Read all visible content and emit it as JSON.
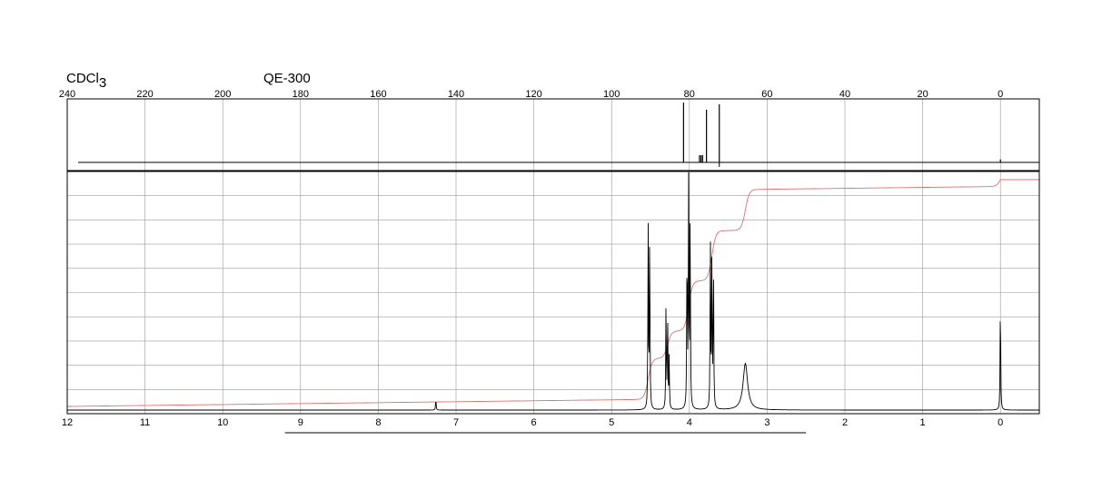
{
  "header": {
    "solvent_prefix": "CDCl",
    "solvent_subscript": "3",
    "instrument": "QE-300"
  },
  "colors": {
    "background": "#ffffff",
    "frame": "#000000",
    "grid": "#9a9a9a",
    "spectrum": "#000000",
    "integral": "#e07070"
  },
  "chart_data": [
    {
      "type": "line",
      "name": "13C spectrum",
      "x_reversed": true,
      "xlim": [
        240,
        -10
      ],
      "x_ticks": [
        240,
        220,
        200,
        180,
        160,
        140,
        120,
        100,
        80,
        60,
        40,
        20,
        0
      ],
      "grid": true,
      "peaks": [
        {
          "x": 81.5,
          "height": 1.0
        },
        {
          "x": 77.4,
          "height": 0.12
        },
        {
          "x": 77.0,
          "height": 0.12
        },
        {
          "x": 76.6,
          "height": 0.12
        },
        {
          "x": 75.6,
          "height": 0.88
        },
        {
          "x": 72.3,
          "height": 0.97
        },
        {
          "x": 0.0,
          "height": 0.05
        }
      ]
    },
    {
      "type": "line",
      "name": "1H spectrum",
      "x_reversed": true,
      "xlim": [
        12,
        -0.5
      ],
      "x_ticks": [
        12,
        11,
        10,
        9,
        8,
        7,
        6,
        5,
        4,
        3,
        2,
        1,
        0
      ],
      "grid": true,
      "peaks": [
        {
          "x": 4.53,
          "height": 0.8
        },
        {
          "x": 4.51,
          "height": 0.78
        },
        {
          "x": 4.3,
          "height": 0.47
        },
        {
          "x": 4.28,
          "height": 0.43
        },
        {
          "x": 4.26,
          "height": 0.22
        },
        {
          "x": 4.03,
          "height": 0.77
        },
        {
          "x": 4.01,
          "height": 1.0
        },
        {
          "x": 3.99,
          "height": 0.9
        },
        {
          "x": 3.73,
          "height": 0.73
        },
        {
          "x": 3.71,
          "height": 0.68
        },
        {
          "x": 3.69,
          "height": 0.65
        },
        {
          "x": 3.28,
          "height": 0.2
        },
        {
          "x": 7.26,
          "height": 0.05
        },
        {
          "x": 0.0,
          "height": 0.51
        }
      ],
      "integral_steps": [
        {
          "x": 4.53,
          "level": 0.18
        },
        {
          "x": 4.28,
          "level": 0.3
        },
        {
          "x": 4.01,
          "level": 0.52
        },
        {
          "x": 3.71,
          "level": 0.74
        },
        {
          "x": 3.28,
          "level": 0.92
        },
        {
          "x": 0.0,
          "level": 0.98
        }
      ],
      "integral_range": [
        9.2,
        2.5
      ]
    }
  ]
}
